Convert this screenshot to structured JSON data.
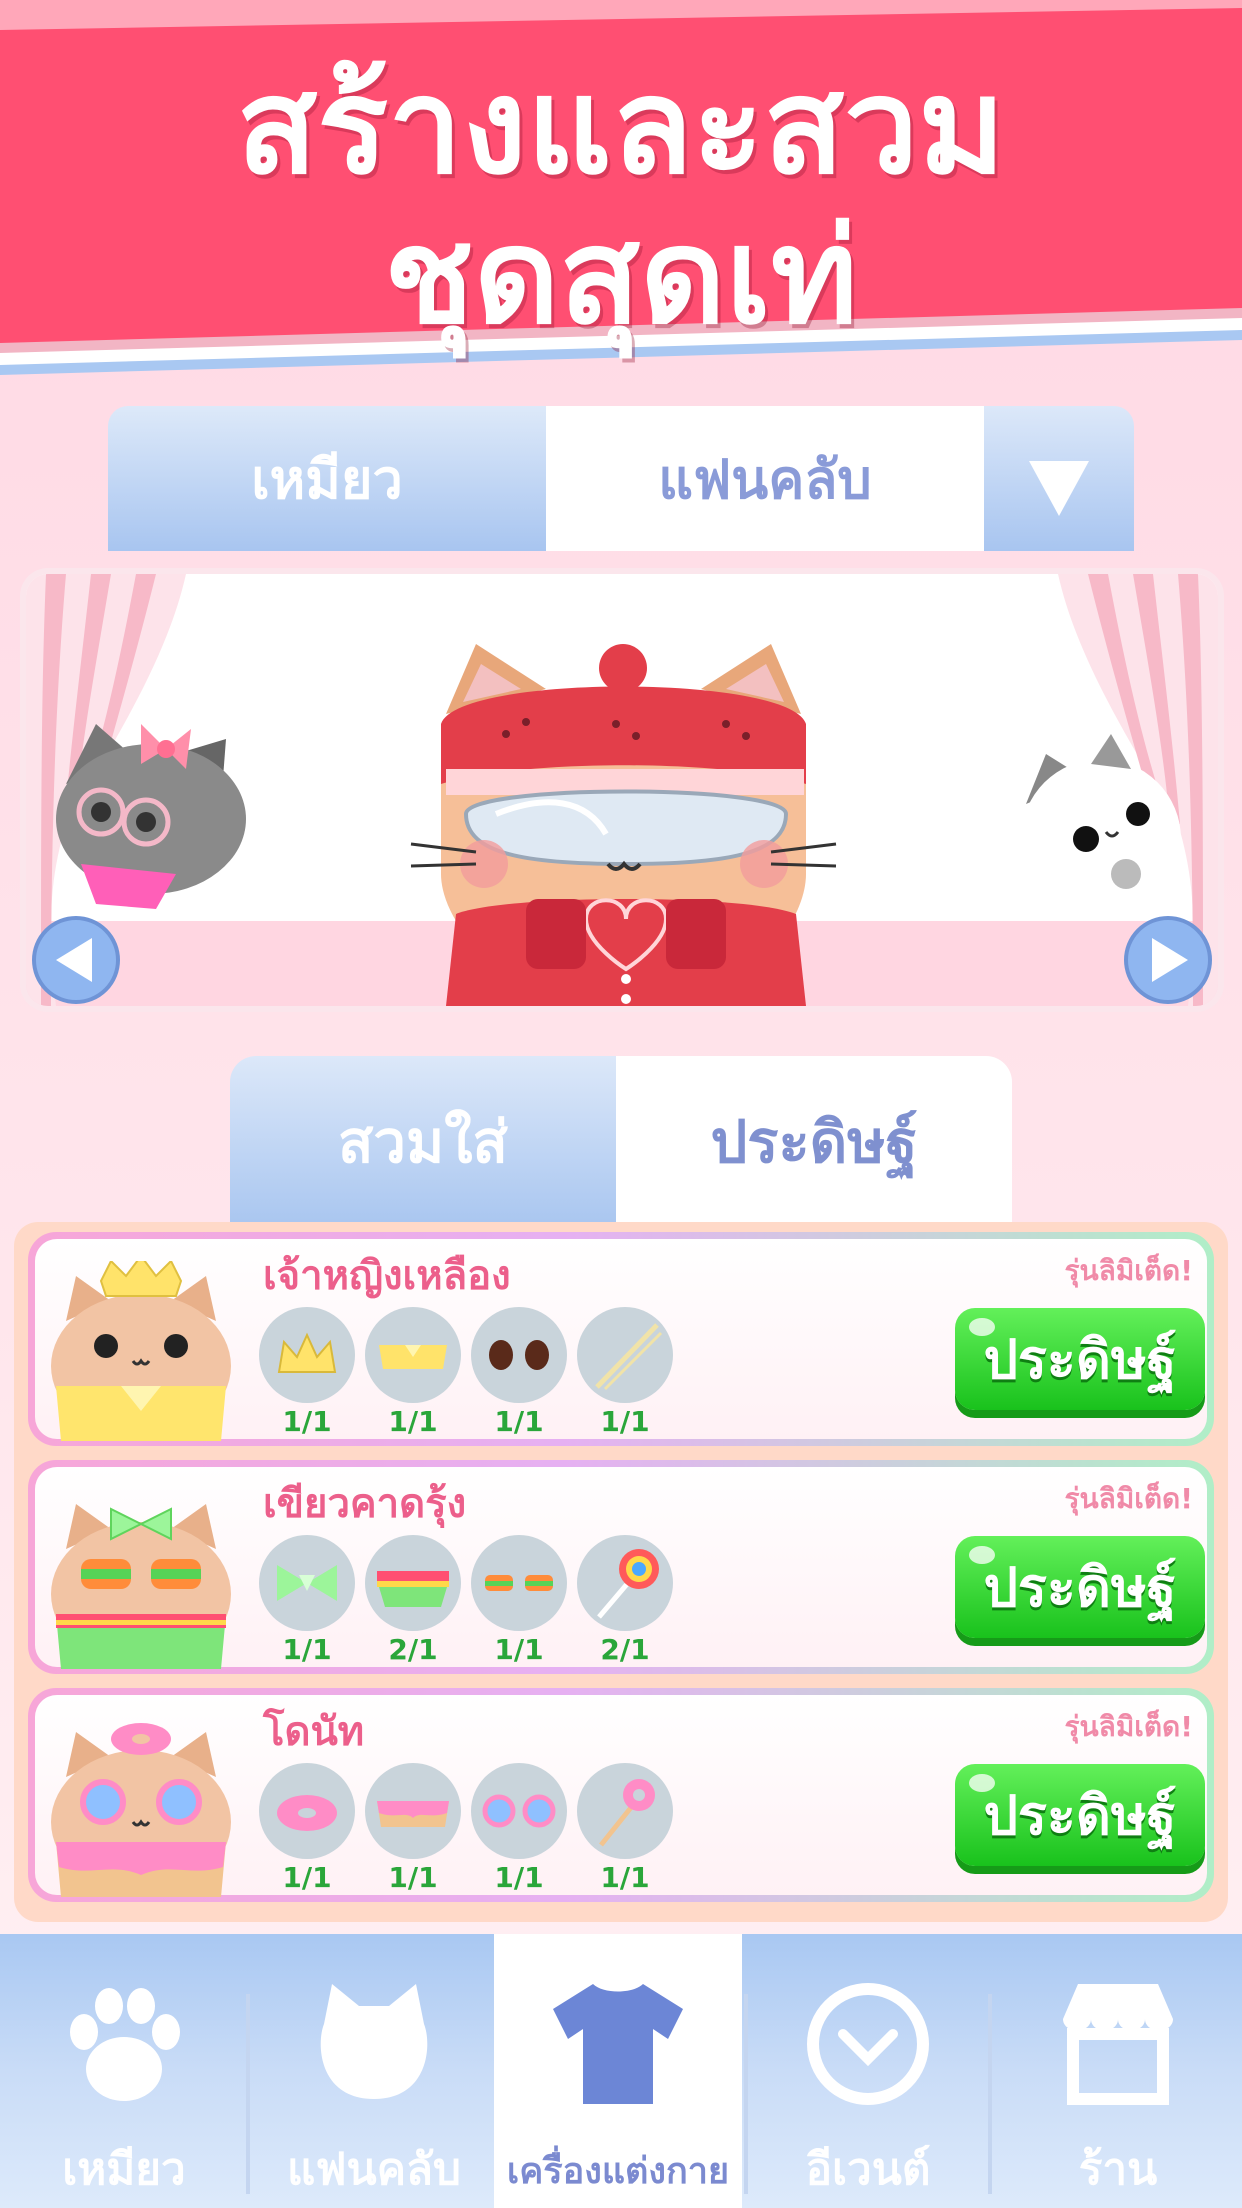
{
  "header": {
    "title_line1": "สร้างและสวม",
    "title_line2": "ชุดสุดเท่"
  },
  "top_tabs": {
    "cats": "เหมียว",
    "fanclub": "แฟนคลับ",
    "dropdown_icon": "triangle-down-icon"
  },
  "stage": {
    "left_arrow_icon": "arrow-left-icon",
    "right_arrow_icon": "arrow-right-icon"
  },
  "sub_tabs": {
    "wear": "สวมใส่",
    "craft": "ประดิษฐ์"
  },
  "outfits": [
    {
      "title": "เจ้าหญิงเหลือง",
      "limited": "รุ่นลิมิเต็ด!",
      "button": "ประดิษฐ์",
      "items": [
        "1/1",
        "1/1",
        "1/1",
        "1/1"
      ]
    },
    {
      "title": "เขียวคาดรุ้ง",
      "limited": "รุ่นลิมิเต็ด!",
      "button": "ประดิษฐ์",
      "items": [
        "1/1",
        "2/1",
        "1/1",
        "2/1"
      ]
    },
    {
      "title": "โดนัท",
      "limited": "รุ่นลิมิเต็ด!",
      "button": "ประดิษฐ์",
      "items": [
        "1/1",
        "1/1",
        "1/1",
        "1/1"
      ]
    }
  ],
  "bottom_nav": [
    {
      "label": "เหมียว",
      "icon": "paw-icon"
    },
    {
      "label": "แฟนคลับ",
      "icon": "cat-head-icon"
    },
    {
      "label": "เครื่องแต่งกาย",
      "icon": "shirt-icon",
      "active": true
    },
    {
      "label": "อีเวนต์",
      "icon": "clock-icon"
    },
    {
      "label": "ร้าน",
      "icon": "shop-icon"
    }
  ],
  "colors": {
    "banner": "#ff4f72",
    "accent_blue": "#a8c5f0",
    "craft_green": "#19c21c",
    "title_pink": "#ec5f8b"
  }
}
